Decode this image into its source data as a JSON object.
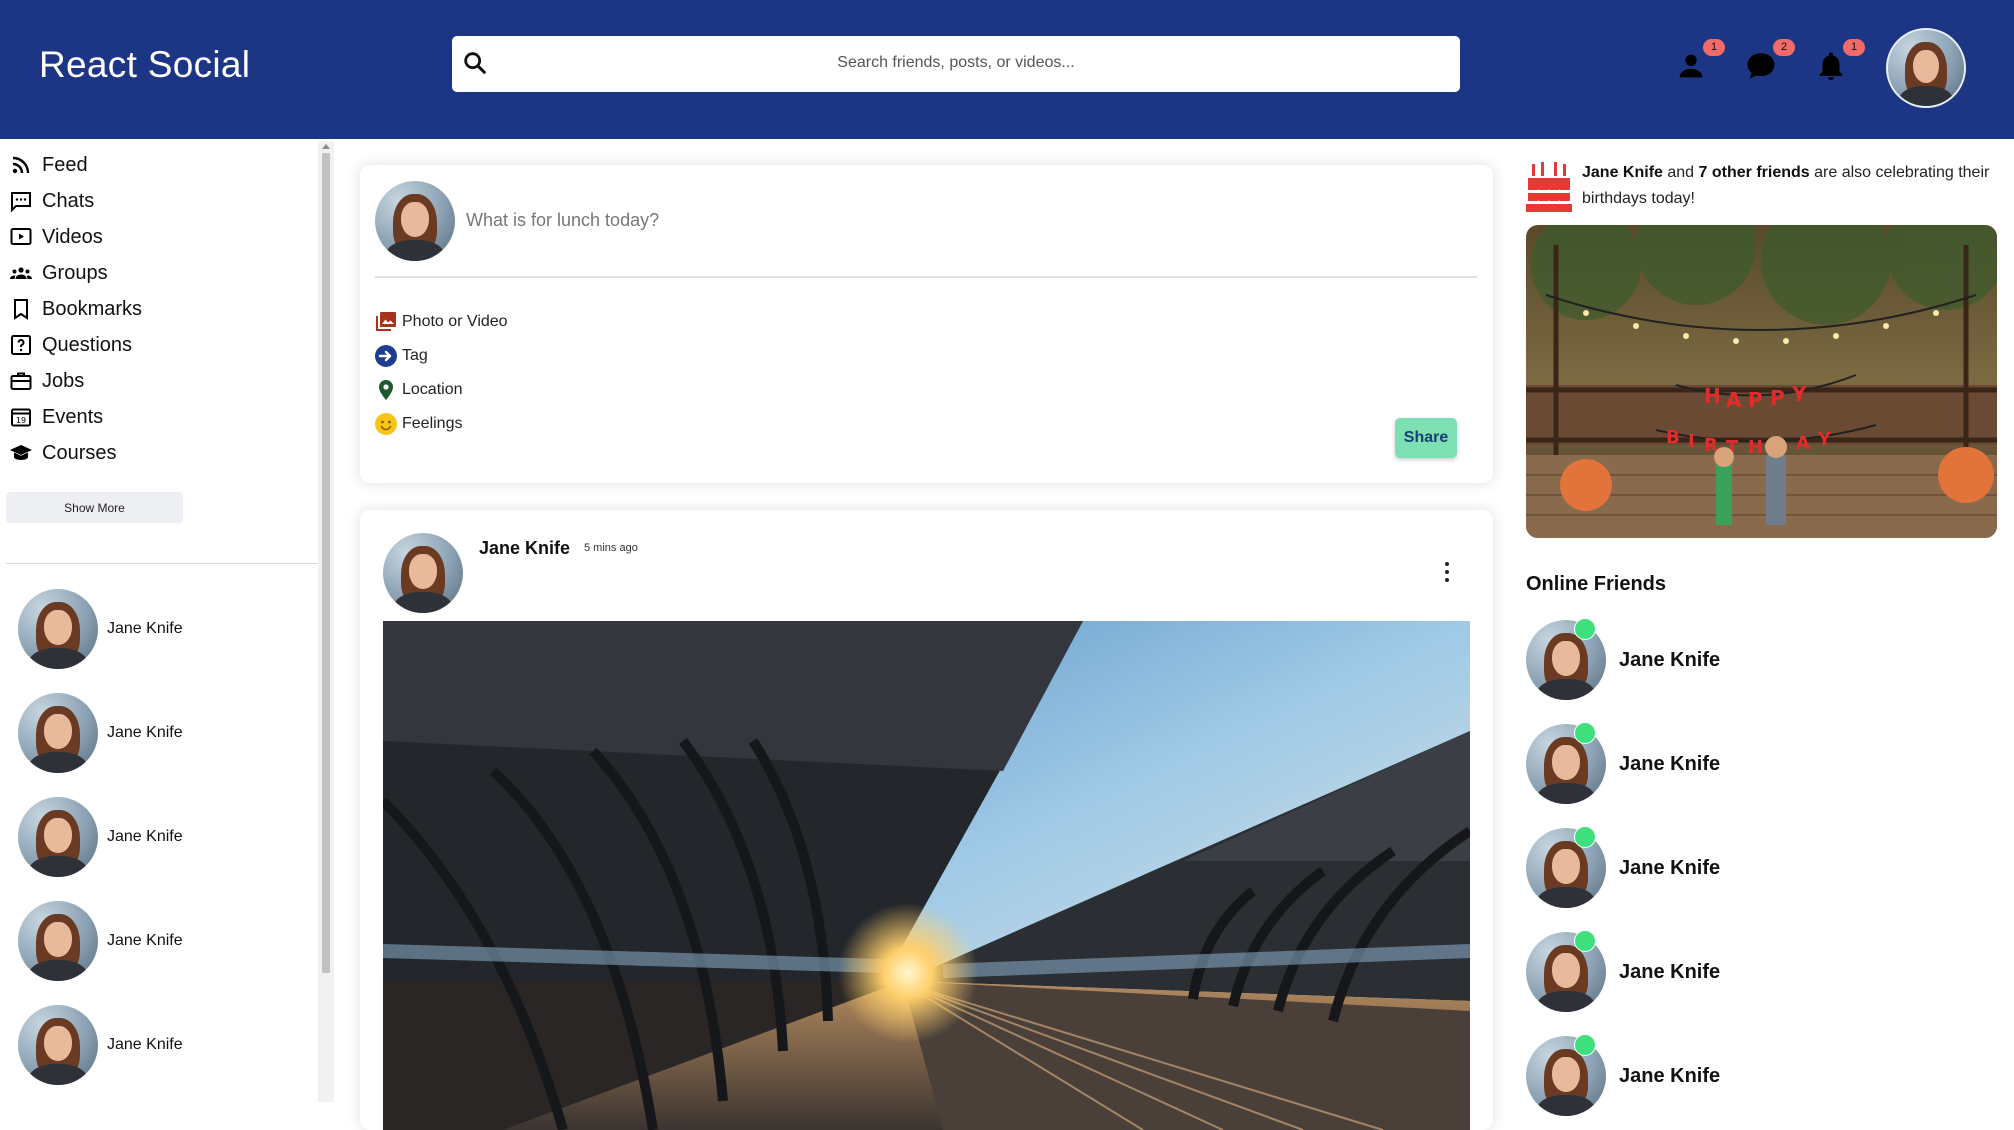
{
  "app": {
    "title": "React Social"
  },
  "search": {
    "placeholder": "Search friends, posts, or videos..."
  },
  "topbar": {
    "icons": [
      {
        "name": "person-icon",
        "badge": "1"
      },
      {
        "name": "chat-icon",
        "badge": "2"
      },
      {
        "name": "notifications-icon",
        "badge": "1"
      }
    ]
  },
  "sidebar": {
    "items": [
      {
        "label": "Feed",
        "icon": "rss-feed-icon"
      },
      {
        "label": "Chats",
        "icon": "chat-bubble-icon"
      },
      {
        "label": "Videos",
        "icon": "play-circle-icon"
      },
      {
        "label": "Groups",
        "icon": "group-icon"
      },
      {
        "label": "Bookmarks",
        "icon": "bookmark-icon"
      },
      {
        "label": "Questions",
        "icon": "help-outline-icon"
      },
      {
        "label": "Jobs",
        "icon": "work-outline-icon"
      },
      {
        "label": "Events",
        "icon": "event-icon"
      },
      {
        "label": "Courses",
        "icon": "school-icon"
      }
    ],
    "show_more": "Show More",
    "friends": [
      "Jane Knife",
      "Jane Knife",
      "Jane Knife",
      "Jane Knife",
      "Jane Knife"
    ]
  },
  "share": {
    "placeholder": "What is for lunch today?",
    "options": [
      {
        "label": "Photo or Video",
        "icon": "perm-media-icon",
        "color": "#a5341f"
      },
      {
        "label": "Tag",
        "icon": "label-icon",
        "color": "#1e3d8f"
      },
      {
        "label": "Location",
        "icon": "room-icon",
        "color": "#1f5a2e"
      },
      {
        "label": "Feelings",
        "icon": "emoji-icon",
        "color": "#f5c518"
      }
    ],
    "button": "Share"
  },
  "post": {
    "author": "Jane Knife",
    "time": "5 mins ago",
    "image": "train-platform-photo"
  },
  "birthday": {
    "name": "Jane Knife",
    "connector": "and",
    "others": "7 other friends",
    "suffix": "are also celebrating their birthdays today!",
    "banner_letters_top": "HAPPY",
    "banner_letters_bottom": "BIRTHDAY"
  },
  "online": {
    "title": "Online Friends",
    "friends": [
      "Jane Knife",
      "Jane Knife",
      "Jane Knife",
      "Jane Knife",
      "Jane Knife"
    ]
  },
  "colors": {
    "topbar": "#1c3685",
    "badge": "#f36a6a",
    "share_button": "#7ce0b2",
    "online_dot": "#3ee07e"
  }
}
